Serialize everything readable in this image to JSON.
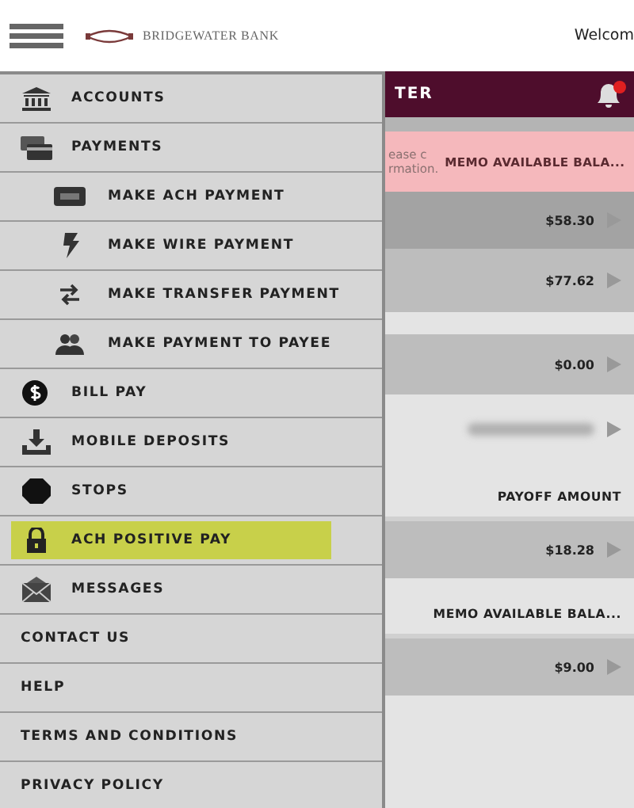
{
  "header": {
    "logo_text": "BRIDGEWATER BANK",
    "greeting": "Welcom"
  },
  "menu": [
    {
      "label": "ACCOUNTS",
      "kind": "icon",
      "selected": false
    },
    {
      "label": "PAYMENTS",
      "kind": "icon",
      "selected": false,
      "children": [
        {
          "label": "MAKE ACH PAYMENT",
          "kind": "icon",
          "selected": false
        },
        {
          "label": "MAKE WIRE PAYMENT",
          "kind": "icon",
          "selected": false
        },
        {
          "label": "MAKE TRANSFER PAYMENT",
          "kind": "icon",
          "selected": false
        },
        {
          "label": "MAKE PAYMENT TO PAYEE",
          "kind": "icon",
          "selected": false
        }
      ]
    },
    {
      "label": "BILL PAY",
      "kind": "icon",
      "selected": false
    },
    {
      "label": "MOBILE DEPOSITS",
      "kind": "icon",
      "selected": false
    },
    {
      "label": "STOPS",
      "kind": "icon",
      "selected": false
    },
    {
      "label": "ACH POSITIVE PAY",
      "kind": "icon",
      "selected": true
    },
    {
      "label": "MESSAGES",
      "kind": "icon",
      "selected": false
    },
    {
      "label": "CONTACT US",
      "kind": "text",
      "selected": false
    },
    {
      "label": "HELP",
      "kind": "text",
      "selected": false
    },
    {
      "label": "TERMS AND CONDITIONS",
      "kind": "text",
      "selected": false
    },
    {
      "label": "PRIVACY POLICY",
      "kind": "text",
      "selected": false
    }
  ],
  "content": {
    "title": "TER",
    "alert": {
      "lines": [
        "ease c",
        "rmation."
      ],
      "label": "MEMO AVAILABLE BALA..."
    },
    "rows": [
      {
        "kind": "amount",
        "text": "$58.30"
      },
      {
        "kind": "amount",
        "text": "$77.62"
      },
      {
        "kind": "amount",
        "text": "$0.00"
      },
      {
        "kind": "blurred"
      },
      {
        "kind": "label",
        "text": "PAYOFF AMOUNT"
      },
      {
        "kind": "amount",
        "text": "$18.28"
      },
      {
        "kind": "label",
        "text": "MEMO AVAILABLE BALA..."
      },
      {
        "kind": "amount",
        "text": "$9.00"
      }
    ]
  }
}
